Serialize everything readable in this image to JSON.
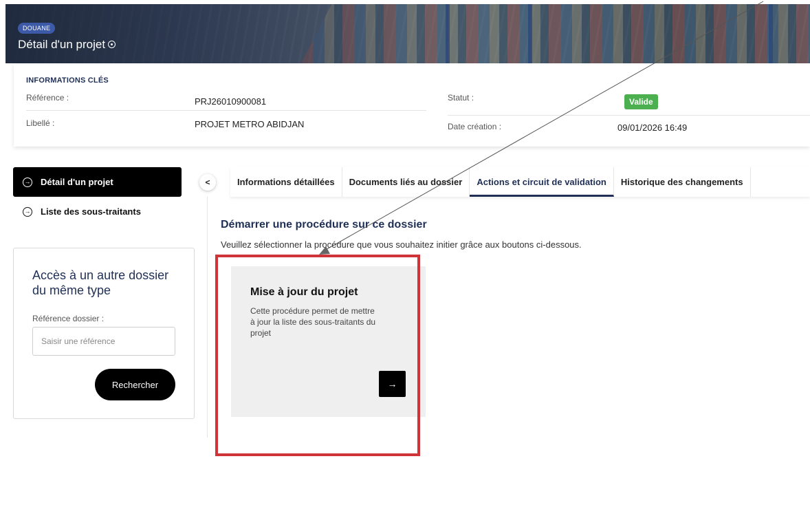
{
  "header": {
    "badge": "DOUANE",
    "title": "Détail d'un projet"
  },
  "key_info": {
    "title": "INFORMATIONS CLÉS",
    "reference_label": "Référence :",
    "reference_value": "PRJ26010900081",
    "libelle_label": "Libellé :",
    "libelle_value": "PROJET METRO ABIDJAN",
    "statut_label": "Statut :",
    "statut_value": "Valide",
    "date_label": "Date création :",
    "date_value": "09/01/2026 16:49",
    "status_color": "#4caf50"
  },
  "sidebar": {
    "items": [
      {
        "label": "Détail d'un projet",
        "active": true
      },
      {
        "label": "Liste des sous-traitants",
        "active": false
      }
    ]
  },
  "search": {
    "title": "Accès à un autre dossier du même type",
    "label": "Référence dossier :",
    "placeholder": "Saisir une référence",
    "button": "Rechercher"
  },
  "tabs": [
    {
      "label": "Informations détaillées",
      "active": false
    },
    {
      "label": "Documents liés au dossier",
      "active": false
    },
    {
      "label": "Actions et circuit de validation",
      "active": true
    },
    {
      "label": "Historique des changements",
      "active": false
    }
  ],
  "procedure": {
    "heading": "Démarrer une procédure sur ce dossier",
    "subtitle": "Veuillez sélectionner la procédure que vous souhaitez initier grâce aux boutons ci-dessous.",
    "card": {
      "title": "Mise à jour du projet",
      "description": "Cette procédure permet de mettre à jour la liste des sous-traitants du projet",
      "button_icon": "arrow-right-icon"
    }
  },
  "colors": {
    "accent": "#1f2f55",
    "badge": "#3d5aa8",
    "highlight": "#d13438"
  }
}
